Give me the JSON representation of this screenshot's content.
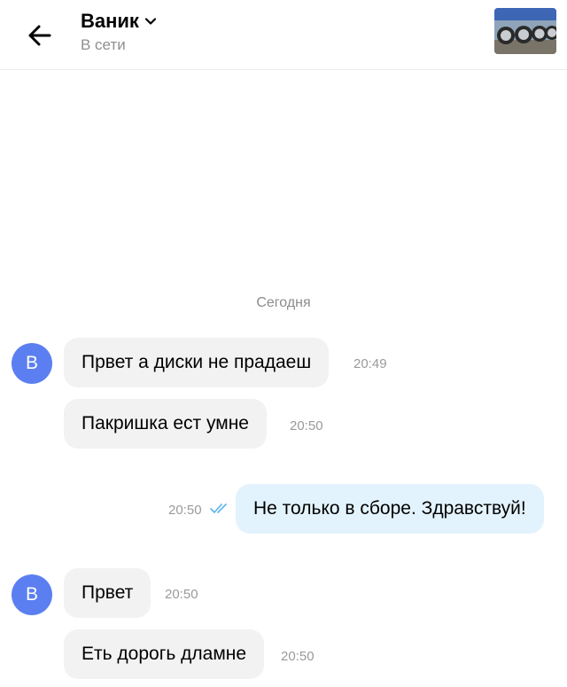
{
  "header": {
    "contact_name": "Ваник",
    "status": "В сети",
    "back_icon": "arrow-left-icon",
    "chevron_icon": "chevron-down-icon",
    "thumbnail": "car-wheels-photo"
  },
  "chat": {
    "date_separator": "Сегодня",
    "messages": [
      {
        "direction": "in",
        "avatar": "В",
        "text": "Првет а диски не прадаеш",
        "time": "20:49"
      },
      {
        "direction": "in",
        "text": "Пакришка ест умне",
        "time": "20:50"
      },
      {
        "direction": "out",
        "text": "Не только в сборе. Здравствуй!",
        "time": "20:50",
        "read": true
      },
      {
        "direction": "in",
        "avatar": "В",
        "text": "Првет",
        "time": "20:50"
      },
      {
        "direction": "in",
        "text": "Еть дорогь дламне",
        "time": "20:50"
      }
    ]
  },
  "colors": {
    "avatar": "#5b7ff0",
    "incoming_bubble": "#f2f2f2",
    "outgoing_bubble": "#e3f3fd",
    "read_check": "#5ab4e8"
  }
}
